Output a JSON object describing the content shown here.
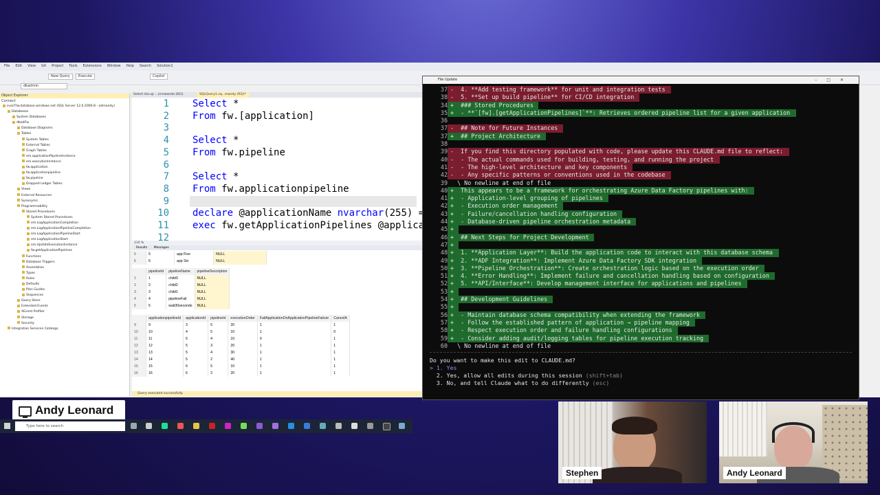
{
  "ssms": {
    "menu": [
      "File",
      "Edit",
      "View",
      "Git",
      "Project",
      "Tools",
      "Extensions",
      "Window",
      "Help",
      "Search",
      "Solution1"
    ],
    "toolbar": {
      "new_query": "New Query",
      "execute": "Execute",
      "copilot": "Copilot",
      "db": "dbadmin"
    },
    "object_explorer": {
      "title": "Object Explorer",
      "connect": "Connect",
      "tree": [
        {
          "label": "svacf?w.database.windows.net (SQL Server 12.0.2000.8 - admandy)",
          "depth": 0
        },
        {
          "label": "Databases",
          "depth": 1
        },
        {
          "label": "System Databases",
          "depth": 2
        },
        {
          "label": "dbadFw",
          "depth": 2
        },
        {
          "label": "Database Diagrams",
          "depth": 3
        },
        {
          "label": "Tables",
          "depth": 3
        },
        {
          "label": "System Tables",
          "depth": 4
        },
        {
          "label": "External Tables",
          "depth": 4
        },
        {
          "label": "Graph Tables",
          "depth": 4
        },
        {
          "label": "em.applicationPipelineInstance",
          "depth": 4
        },
        {
          "label": "em.executionInstance",
          "depth": 4
        },
        {
          "label": "fw.application",
          "depth": 4
        },
        {
          "label": "fw.applicationpipeline",
          "depth": 4
        },
        {
          "label": "fw.pipeline",
          "depth": 4
        },
        {
          "label": "Dropped Ledger Tables",
          "depth": 4
        },
        {
          "label": "Views",
          "depth": 3
        },
        {
          "label": "External Resources",
          "depth": 3
        },
        {
          "label": "Synonyms",
          "depth": 3
        },
        {
          "label": "Programmability",
          "depth": 3
        },
        {
          "label": "Stored Procedures",
          "depth": 4
        },
        {
          "label": "System Stored Procedures",
          "depth": 5
        },
        {
          "label": "em.LogApplicationCompletion",
          "depth": 5
        },
        {
          "label": "em.LogApplicationPipelineCompletion",
          "depth": 5
        },
        {
          "label": "em.LogApplicationPipelineStart",
          "depth": 5
        },
        {
          "label": "em.LogApplicationStart",
          "depth": 5
        },
        {
          "label": "em.UpdateExecutionInstance",
          "depth": 5
        },
        {
          "label": "fw.getApplicationPipelines",
          "depth": 5
        },
        {
          "label": "Functions",
          "depth": 4
        },
        {
          "label": "Database Triggers",
          "depth": 4
        },
        {
          "label": "Assemblies",
          "depth": 4
        },
        {
          "label": "Types",
          "depth": 4
        },
        {
          "label": "Rules",
          "depth": 4
        },
        {
          "label": "Defaults",
          "depth": 4
        },
        {
          "label": "Plan Guides",
          "depth": 4
        },
        {
          "label": "Sequences",
          "depth": 4
        },
        {
          "label": "Query Store",
          "depth": 3
        },
        {
          "label": "Extended Events",
          "depth": 3
        },
        {
          "label": "XEvent Profiler",
          "depth": 3
        },
        {
          "label": "Storage",
          "depth": 3
        },
        {
          "label": "Security",
          "depth": 3
        },
        {
          "label": "Integration Services Catalogs",
          "depth": 1
        }
      ]
    },
    "tabs": [
      "Select sta.up ...(crewanda (82))",
      "SQLQuery1.sq...mandy (93))*"
    ],
    "editor_lines": [
      {
        "n": "1",
        "parts": [
          [
            "kw",
            "Select "
          ],
          [
            "",
            "*"
          ]
        ]
      },
      {
        "n": "2",
        "parts": [
          [
            "kw",
            "From "
          ],
          [
            "",
            "fw.[application]"
          ]
        ]
      },
      {
        "n": "3",
        "parts": []
      },
      {
        "n": "4",
        "parts": [
          [
            "kw",
            "Select "
          ],
          [
            "",
            "*"
          ]
        ]
      },
      {
        "n": "5",
        "parts": [
          [
            "kw",
            "From "
          ],
          [
            "",
            "fw.pipeline"
          ]
        ]
      },
      {
        "n": "6",
        "parts": []
      },
      {
        "n": "7",
        "parts": [
          [
            "kw",
            "Select "
          ],
          [
            "",
            "*"
          ]
        ]
      },
      {
        "n": "8",
        "parts": [
          [
            "kw",
            "From "
          ],
          [
            "",
            "fw.applicationpipeline"
          ]
        ]
      },
      {
        "n": "9",
        "parts": []
      },
      {
        "n": "10",
        "parts": [
          [
            "kw",
            "declare "
          ],
          [
            "",
            "@applicationName "
          ],
          [
            "kw",
            "nvarchar"
          ],
          [
            "",
            "(255) ="
          ]
        ]
      },
      {
        "n": "11",
        "parts": [
          [
            "kw",
            "exec "
          ],
          [
            "",
            "fw.getApplicationPipelines @applicat"
          ]
        ]
      },
      {
        "n": "12",
        "parts": []
      }
    ],
    "zoom": "110 %",
    "result_tabs": [
      "Results",
      "Messages"
    ],
    "grid1": {
      "rows": [
        [
          "5",
          "5",
          "app Five",
          "NULL"
        ],
        [
          "6",
          "6",
          "app Six",
          "NULL"
        ]
      ]
    },
    "grid2": {
      "headers": [
        "",
        "pipelineId",
        "pipelineName",
        "pipelineDescription"
      ],
      "rows": [
        [
          "1",
          "1",
          "child3",
          "NULL"
        ],
        [
          "2",
          "2",
          "child2",
          "NULL"
        ],
        [
          "3",
          "3",
          "child1",
          "NULL"
        ],
        [
          "4",
          "4",
          "pipelineFail",
          "NULL"
        ],
        [
          "5",
          "5",
          "wait30seconds",
          "NULL"
        ]
      ]
    },
    "grid3": {
      "headers": [
        "",
        "applicationpipelineId",
        "applicationId",
        "pipelineId",
        "executionOrder",
        "FailApplicationOnApplicationPipelineFailure",
        "CancelA"
      ],
      "rows": [
        [
          "9",
          "9",
          "3",
          "5",
          "20",
          "1",
          "1"
        ],
        [
          "10",
          "10",
          "4",
          "5",
          "10",
          "1",
          "0"
        ],
        [
          "11",
          "11",
          "5",
          "4",
          "10",
          "0",
          "1"
        ],
        [
          "12",
          "12",
          "5",
          "3",
          "20",
          "1",
          "1"
        ],
        [
          "13",
          "13",
          "5",
          "4",
          "30",
          "1",
          "1"
        ],
        [
          "14",
          "14",
          "5",
          "2",
          "40",
          "1",
          "1"
        ],
        [
          "15",
          "15",
          "6",
          "5",
          "10",
          "1",
          "1"
        ],
        [
          "16",
          "16",
          "6",
          "2",
          "20",
          "1",
          "1"
        ]
      ]
    },
    "status": "Query executed successfully."
  },
  "terminal": {
    "title": "File Update",
    "lines": [
      {
        "n": "37",
        "s": "-",
        "t": "  4. **Add testing framework** for unit and integration tests",
        "k": "rem"
      },
      {
        "n": "38",
        "s": "-",
        "t": "  5. **Set up build pipeline** for CI/CD integration",
        "k": "rem"
      },
      {
        "n": "34",
        "s": "+",
        "t": "  ### Stored Procedures",
        "k": "add"
      },
      {
        "n": "35",
        "s": "+",
        "t": "  - **`[fw].[getApplicationPipelines]`**: Retrieves ordered pipeline list for a given application",
        "k": "add"
      },
      {
        "n": "36",
        "s": "",
        "t": "",
        "k": ""
      },
      {
        "n": "37",
        "s": "-",
        "t": "  ## Note for Future Instances",
        "k": "rem"
      },
      {
        "n": "37",
        "s": "+",
        "t": "  ## Project Architecture",
        "k": "add"
      },
      {
        "n": "38",
        "s": "",
        "t": "",
        "k": ""
      },
      {
        "n": "39",
        "s": "-",
        "t": "  If you find this directory populated with code, please update this CLAUDE.md file to reflect:",
        "k": "rem"
      },
      {
        "n": "40",
        "s": "-",
        "t": "  - The actual commands used for building, testing, and running the project",
        "k": "rem"
      },
      {
        "n": "41",
        "s": "-",
        "t": "  - The high-level architecture and key components",
        "k": "rem"
      },
      {
        "n": "42",
        "s": "-",
        "t": "  - Any specific patterns or conventions used in the codebase",
        "k": "rem"
      },
      {
        "n": "39",
        "s": "",
        "t": "  \\ No newline at end of file",
        "k": ""
      },
      {
        "n": "40",
        "s": "+",
        "t": "  This appears to be a framework for orchestrating Azure Data Factory pipelines with:",
        "k": "add"
      },
      {
        "n": "41",
        "s": "+",
        "t": "  - Application-level grouping of pipelines",
        "k": "add"
      },
      {
        "n": "42",
        "s": "+",
        "t": "  - Execution order management",
        "k": "add"
      },
      {
        "n": "43",
        "s": "+",
        "t": "  - Failure/cancellation handling configuration",
        "k": "add"
      },
      {
        "n": "44",
        "s": "+",
        "t": "  - Database-driven pipeline orchestration metadata",
        "k": "add"
      },
      {
        "n": "45",
        "s": "+",
        "t": "",
        "k": "add"
      },
      {
        "n": "46",
        "s": "+",
        "t": "  ## Next Steps for Project Development",
        "k": "add"
      },
      {
        "n": "47",
        "s": "+",
        "t": "",
        "k": "add"
      },
      {
        "n": "48",
        "s": "+",
        "t": "  1. **Application Layer**: Build the application code to interact with this database schema",
        "k": "add"
      },
      {
        "n": "49",
        "s": "+",
        "t": "  2. **ADF Integration**: Implement Azure Data Factory SDK integration",
        "k": "add"
      },
      {
        "n": "50",
        "s": "+",
        "t": "  3. **Pipeline Orchestration**: Create orchestration logic based on the execution order",
        "k": "add"
      },
      {
        "n": "51",
        "s": "+",
        "t": "  4. **Error Handling**: Implement failure and cancellation handling based on configuration",
        "k": "add"
      },
      {
        "n": "52",
        "s": "+",
        "t": "  5. **API/Interface**: Develop management interface for applications and pipelines",
        "k": "add"
      },
      {
        "n": "53",
        "s": "+",
        "t": "",
        "k": "add"
      },
      {
        "n": "54",
        "s": "+",
        "t": "  ## Development Guidelines",
        "k": "add"
      },
      {
        "n": "55",
        "s": "+",
        "t": "",
        "k": "add"
      },
      {
        "n": "56",
        "s": "+",
        "t": "  - Maintain database schema compatibility when extending the framework",
        "k": "add"
      },
      {
        "n": "57",
        "s": "+",
        "t": "  - Follow the established pattern of application → pipeline mapping",
        "k": "add"
      },
      {
        "n": "58",
        "s": "+",
        "t": "  - Respect execution order and failure handling configurations",
        "k": "add"
      },
      {
        "n": "59",
        "s": "+",
        "t": "  - Consider adding audit/logging tables for pipeline execution tracking",
        "k": "add"
      },
      {
        "n": "60",
        "s": "",
        "t": "  \\ No newline at end of file",
        "k": ""
      }
    ],
    "question": "Do you want to make this edit to CLAUDE.md?",
    "options": [
      {
        "prefix": "> 1. ",
        "label": "Yes",
        "hint": ""
      },
      {
        "prefix": "  2. ",
        "label": "Yes, allow all edits during this session ",
        "hint": "(shift+tab)"
      },
      {
        "prefix": "  3. ",
        "label": "No, and tell Claude what to do differently ",
        "hint": "(esc)"
      }
    ]
  },
  "taskbar": {
    "search_placeholder": "Type here to search"
  },
  "presenter_card": {
    "name": "Andy Leonard"
  },
  "webcams": [
    {
      "name": "Stephen"
    },
    {
      "name": "Andy Leonard"
    }
  ]
}
